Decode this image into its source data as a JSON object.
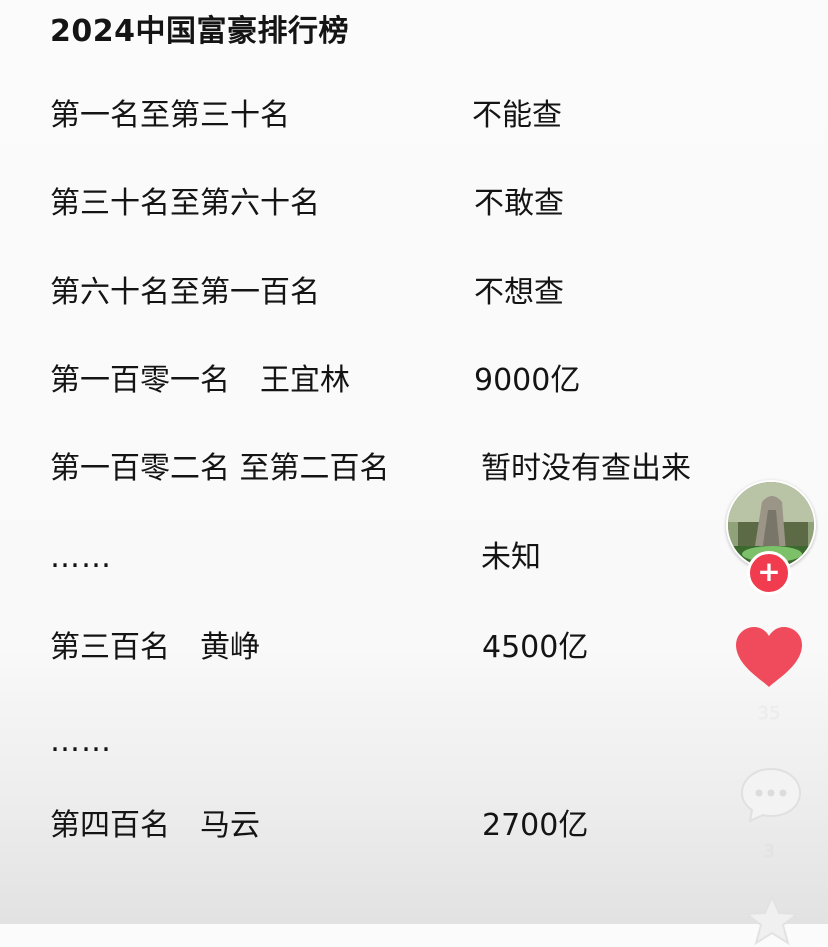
{
  "title": "2024中国富豪排行榜",
  "rows": [
    {
      "rank": "第一名至第三十名",
      "value": "不能查"
    },
    {
      "rank": "第三十名至第六十名",
      "value": "不敢查"
    },
    {
      "rank": "第六十名至第一百名",
      "value": "不想查"
    },
    {
      "rank": "第一百零一名　王宜林",
      "value": "9000亿"
    },
    {
      "rank": "第一百零二名 至第二百名",
      "value": "暂时没有查出来"
    },
    {
      "rank": "……",
      "value": "未知"
    },
    {
      "rank": "第三百名　黄峥",
      "value": "4500亿"
    },
    {
      "rank": "……",
      "value": ""
    },
    {
      "rank": "第四百名　马云",
      "value": "2700亿"
    }
  ],
  "sidebar": {
    "follow_symbol": "+",
    "like_count": "35",
    "comment_count": "3",
    "icons": {
      "avatar": "avatar-image",
      "follow": "plus-icon",
      "like": "heart-icon",
      "comment": "comment-bubble-icon",
      "favorite": "star-icon"
    },
    "colors": {
      "accent": "#f03c4e",
      "heart": "#f04b5c"
    }
  }
}
